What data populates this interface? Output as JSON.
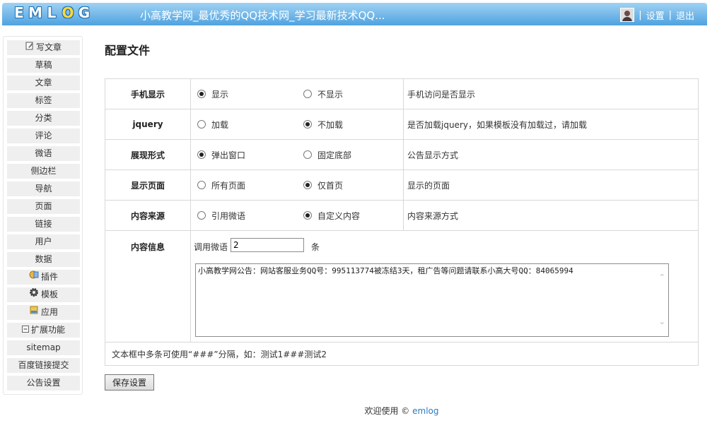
{
  "header": {
    "logo_letters": [
      "E",
      "M",
      "L",
      "O",
      "G"
    ],
    "site_title": "小高教学网_最优秀的QQ技术网_学习最新技术QQ...",
    "sep": "|",
    "settings": "设置",
    "logout": "退出"
  },
  "sidebar": {
    "items": [
      {
        "label": "写文章",
        "icon": "edit-icon"
      },
      {
        "label": "草稿"
      },
      {
        "label": "文章"
      },
      {
        "label": "标签"
      },
      {
        "label": "分类"
      },
      {
        "label": "评论"
      },
      {
        "label": "微语"
      },
      {
        "label": "侧边栏"
      },
      {
        "label": "导航"
      },
      {
        "label": "页面"
      },
      {
        "label": "链接"
      },
      {
        "label": "用户"
      },
      {
        "label": "数据"
      },
      {
        "label": "插件",
        "icon": "plugin-icon"
      },
      {
        "label": "模板",
        "icon": "gear-icon"
      },
      {
        "label": "应用",
        "icon": "app-icon"
      },
      {
        "label": "扩展功能",
        "icon": "collapse-icon"
      },
      {
        "label": "sitemap"
      },
      {
        "label": "百度链接提交"
      },
      {
        "label": "公告设置"
      }
    ]
  },
  "main": {
    "title": "配置文件",
    "rows": [
      {
        "label": "手机显示",
        "options": [
          "显示",
          "不显示"
        ],
        "selected": 0,
        "desc": "手机访问是否显示"
      },
      {
        "label": "jquery",
        "options": [
          "加载",
          "不加载"
        ],
        "selected": 1,
        "desc": "是否加载jquery，如果模板没有加载过，请加载"
      },
      {
        "label": "展现形式",
        "options": [
          "弹出窗口",
          "固定底部"
        ],
        "selected": 0,
        "desc": "公告显示方式"
      },
      {
        "label": "显示页面",
        "options": [
          "所有页面",
          "仅首页"
        ],
        "selected": 1,
        "desc": "显示的页面"
      },
      {
        "label": "内容来源",
        "options": [
          "引用微语",
          "自定义内容"
        ],
        "selected": 1,
        "desc": "内容来源方式"
      }
    ],
    "info": {
      "label": "内容信息",
      "count_label": "调用微语",
      "count_value": "2",
      "count_unit": "条",
      "content": "小高教学网公告：网站客服业务QQ号：995113774被冻结3天，租广告等问题请联系小高大号QQ：84065994"
    },
    "hint": "文本框中多条可使用“###”分隔，如：测试1###测试2",
    "save_label": "保存设置"
  },
  "footer": {
    "text": "欢迎使用 ©",
    "link": "emlog"
  }
}
